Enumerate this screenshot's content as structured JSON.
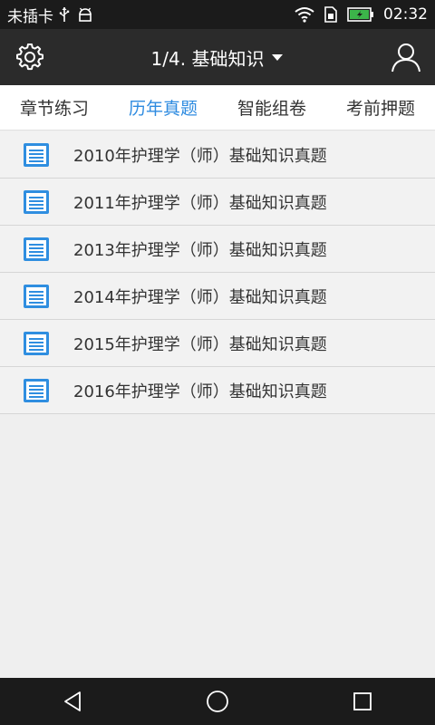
{
  "status_bar": {
    "carrier": "未插卡",
    "time": "02:32",
    "icons": [
      "usb-icon",
      "android-debug-icon",
      "wifi-icon",
      "sim-icon",
      "battery-charging-icon"
    ]
  },
  "header": {
    "title": "1/4. 基础知识",
    "left_icon": "settings-gear-icon",
    "right_icon": "user-profile-icon"
  },
  "tabs": [
    {
      "label": "章节练习",
      "active": false
    },
    {
      "label": "历年真题",
      "active": true
    },
    {
      "label": "智能组卷",
      "active": false
    },
    {
      "label": "考前押题",
      "active": false
    }
  ],
  "exam_list": [
    {
      "label": "2010年护理学（师）基础知识真题"
    },
    {
      "label": "2011年护理学（师）基础知识真题"
    },
    {
      "label": "2013年护理学（师）基础知识真题"
    },
    {
      "label": "2014年护理学（师）基础知识真题"
    },
    {
      "label": "2015年护理学（师）基础知识真题"
    },
    {
      "label": "2016年护理学（师）基础知识真题"
    }
  ],
  "nav_bar": {
    "icons": [
      "back-triangle-icon",
      "home-circle-icon",
      "recents-square-icon"
    ]
  },
  "colors": {
    "accent": "#2e8be0",
    "document_icon": "#2f8ee0",
    "battery_charge": "#3cb44a"
  }
}
